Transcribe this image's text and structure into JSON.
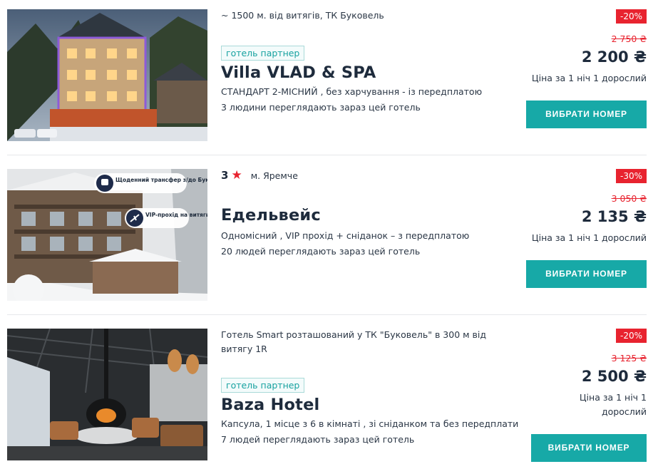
{
  "hotels": [
    {
      "location": "~ 1500 м. від витягів, ТК Буковель",
      "partner_badge": "готель партнер",
      "name": "Villa VLAD & SPA",
      "room": "СТАНДАРТ 2-МІСНИЙ , без харчування - із передплатою",
      "viewers": "3 людини переглядають зараз цей готель",
      "discount": "-20%",
      "old_price": "2 750 ₴",
      "price": "2 200 ₴",
      "per_night": "Ціна за 1 ніч  1 дорослий",
      "button": "ВИБРАТИ НОМЕР"
    },
    {
      "stars": "3",
      "city": "м. Яремче",
      "name": "Едельвейс",
      "room": "Одномісний , VIP прохід + сніданок – з передплатою",
      "viewers": "20 людей переглядають зараз цей готель",
      "discount": "-30%",
      "old_price": "3 050 ₴",
      "price": "2 135 ₴",
      "per_night": "Ціна за 1 ніч  1 дорослий",
      "button": "ВИБРАТИ НОМЕР",
      "photo_badges": [
        "Щоденний трансфер з/до Буковелю",
        "VIP-прохід на витяги"
      ]
    },
    {
      "location": "Готель Smart розташований у ТК \"Буковель\" в 300 м від витягу 1R",
      "partner_badge": "готель партнер",
      "name": "Baza Hotel",
      "room": "Капсула, 1 місце з 6 в кімнаті , зі сніданком та без передплати",
      "viewers": "7 людей переглядають зараз цей готель",
      "discount": "-20%",
      "old_price": "3 125 ₴",
      "price": "2 500 ₴",
      "per_night": "Ціна за 1 ніч  1 дорослий",
      "button": "ВИБРАТИ НОМЕР"
    }
  ],
  "colors": {
    "accent": "#17a9a7",
    "discount": "#e8232f",
    "text": "#1e2b3c"
  },
  "icons": {
    "star": "star-icon",
    "bus": "bus-icon",
    "skier": "skier-icon"
  }
}
